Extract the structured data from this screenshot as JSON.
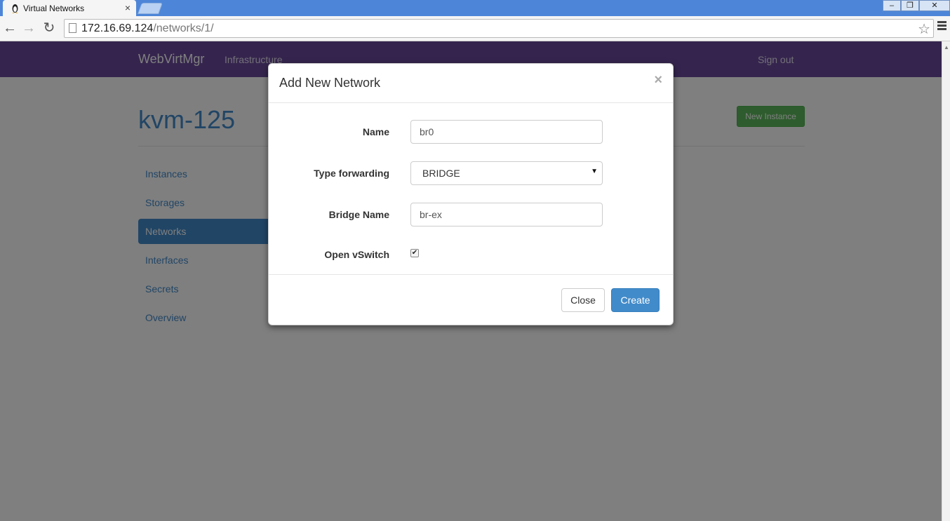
{
  "browser": {
    "tab_title": "Virtual Networks",
    "tab_close": "×",
    "url_host": "172.16.69.124",
    "url_path": "/networks/1/",
    "window_controls": [
      "–",
      "❐",
      "✕"
    ]
  },
  "navbar": {
    "brand": "WebVirtMgr",
    "infrastructure": "Infrastructure",
    "sign_out": "Sign out"
  },
  "page": {
    "host_title": "kvm-125",
    "new_instance": "New Instance",
    "side_nav": [
      {
        "label": "Instances",
        "active": false
      },
      {
        "label": "Storages",
        "active": false
      },
      {
        "label": "Networks",
        "active": true
      },
      {
        "label": "Interfaces",
        "active": false
      },
      {
        "label": "Secrets",
        "active": false
      },
      {
        "label": "Overview",
        "active": false
      }
    ]
  },
  "modal": {
    "title": "Add New Network",
    "close_x": "×",
    "fields": {
      "name_label": "Name",
      "name_value": "br0",
      "type_label": "Type forwarding",
      "type_value": "BRIDGE",
      "bridge_label": "Bridge Name",
      "bridge_value": "br-ex",
      "ovs_label": "Open vSwitch",
      "ovs_checked": true
    },
    "close_button": "Close",
    "create_button": "Create"
  },
  "colors": {
    "navbar": "#6a4a9c",
    "primary": "#428bca",
    "success": "#5cb85c"
  }
}
